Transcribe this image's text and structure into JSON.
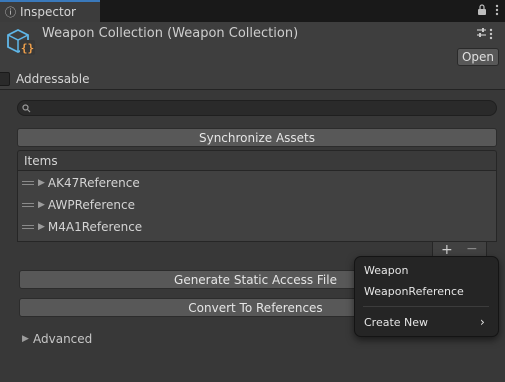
{
  "tab": {
    "label": "Inspector",
    "icon": "info-icon"
  },
  "header": {
    "title": "Weapon Collection (Weapon Collection)",
    "open_label": "Open",
    "asset_icon": "scriptable-object-icon"
  },
  "addressable": {
    "label": "Addressable",
    "checked": false
  },
  "search": {
    "value": "",
    "placeholder": ""
  },
  "sync_button": "Synchronize Assets",
  "list": {
    "header": "Items",
    "items": [
      "AK47Reference",
      "AWPReference",
      "M4A1Reference"
    ],
    "add_label": "+",
    "remove_label": "−"
  },
  "generate_button": "Generate Static Access File",
  "convert_button": "Convert To References",
  "advanced": {
    "label": "Advanced",
    "expanded": false
  },
  "context_menu": {
    "items": [
      "Weapon",
      "WeaponReference"
    ],
    "submenu": "Create New",
    "submenu_arrow": "›"
  },
  "colors": {
    "background": "#383838",
    "header": "#3e3e3e",
    "button": "#585858",
    "menu": "#252525",
    "tab_accent": "#3a79bb",
    "icon_blue": "#5fb6e8",
    "icon_orange": "#f0a04b"
  }
}
